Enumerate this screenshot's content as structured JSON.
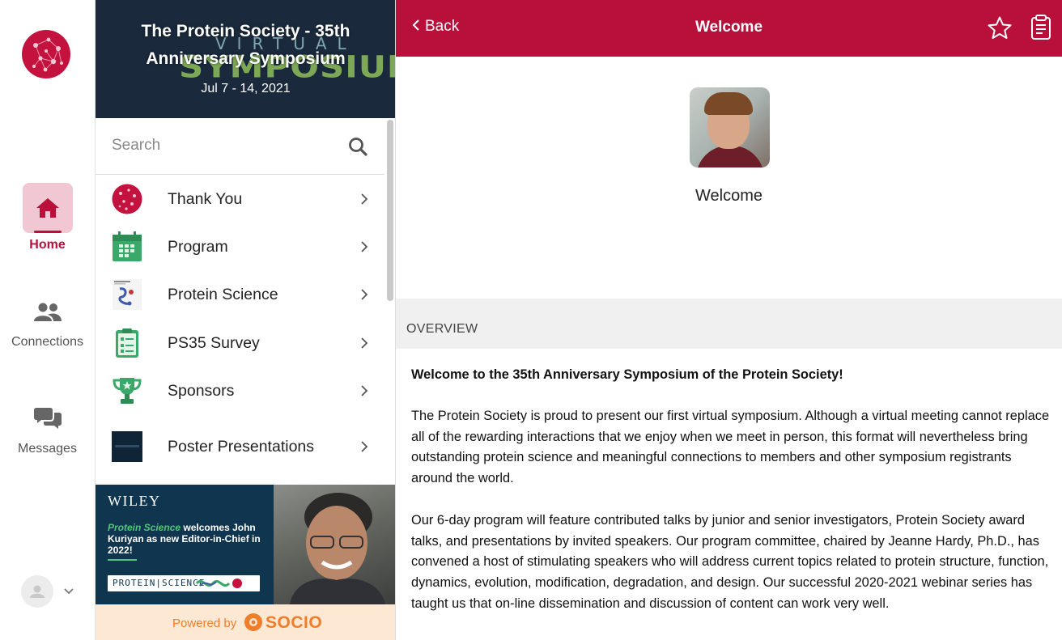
{
  "rail": {
    "items": [
      {
        "label": "Home",
        "icon": "home-icon",
        "active": true
      },
      {
        "label": "Connections",
        "icon": "people-icon"
      },
      {
        "label": "Messages",
        "icon": "chat-icon"
      }
    ]
  },
  "panel": {
    "banner": {
      "title": "The Protein Society - 35th Anniversary Symposium",
      "dates": "Jul 7 - 14, 2021",
      "bg_word_1": "VIRTUAL",
      "bg_word_2": "SYMPOSIUM"
    },
    "search": {
      "placeholder": "Search"
    },
    "menu": [
      {
        "label": "Thank You",
        "icon": "society-logo-icon"
      },
      {
        "label": "Program",
        "icon": "calendar-icon"
      },
      {
        "label": "Protein Science",
        "icon": "journal-cover-icon"
      },
      {
        "label": "PS35 Survey",
        "icon": "clipboard-icon"
      },
      {
        "label": "Sponsors",
        "icon": "trophy-icon"
      },
      {
        "label": "Poster Presentations",
        "icon": "poster-icon"
      }
    ],
    "ad": {
      "brand": "WILEY",
      "highlight": "Protein Science",
      "text": " welcomes John Kuriyan as new Editor-in-Chief in 2022!",
      "strip": "PROTEIN|SCIENCE"
    },
    "powered": {
      "text": "Powered by",
      "brand": "SOCIO"
    }
  },
  "content": {
    "header": {
      "back": "Back",
      "title": "Welcome"
    },
    "profile_label": "Welcome",
    "section_title": "OVERVIEW",
    "body": {
      "lead": "Welcome to the 35th Anniversary Symposium of the Protein Society!",
      "p1": "The Protein Society is proud to present our first virtual symposium. Although a virtual meeting cannot replace all of the rewarding interactions that we enjoy when we meet in person, this format will nevertheless bring outstanding protein science and meaningful connections to members and other symposium registrants around the world.",
      "p2": "Our 6-day program will feature contributed talks by junior and senior investigators, Protein Society award talks, and presentations by invited speakers. Our program committee, chaired by Jeanne Hardy, Ph.D., has convened a host of stimulating speakers who will address current topics related to protein structure, function, dynamics, evolution, modification, degradation, and design. Our successful 2020-2021 webinar series has taught us that on-line dissemination and discussion of content can work very well."
    }
  },
  "colors": {
    "accent": "#b8103a",
    "active_bg": "#f1c7d3",
    "banner_bg": "#1a2a3c",
    "powered_bg": "#fde8d3",
    "socio_orange": "#ef7d2a"
  }
}
